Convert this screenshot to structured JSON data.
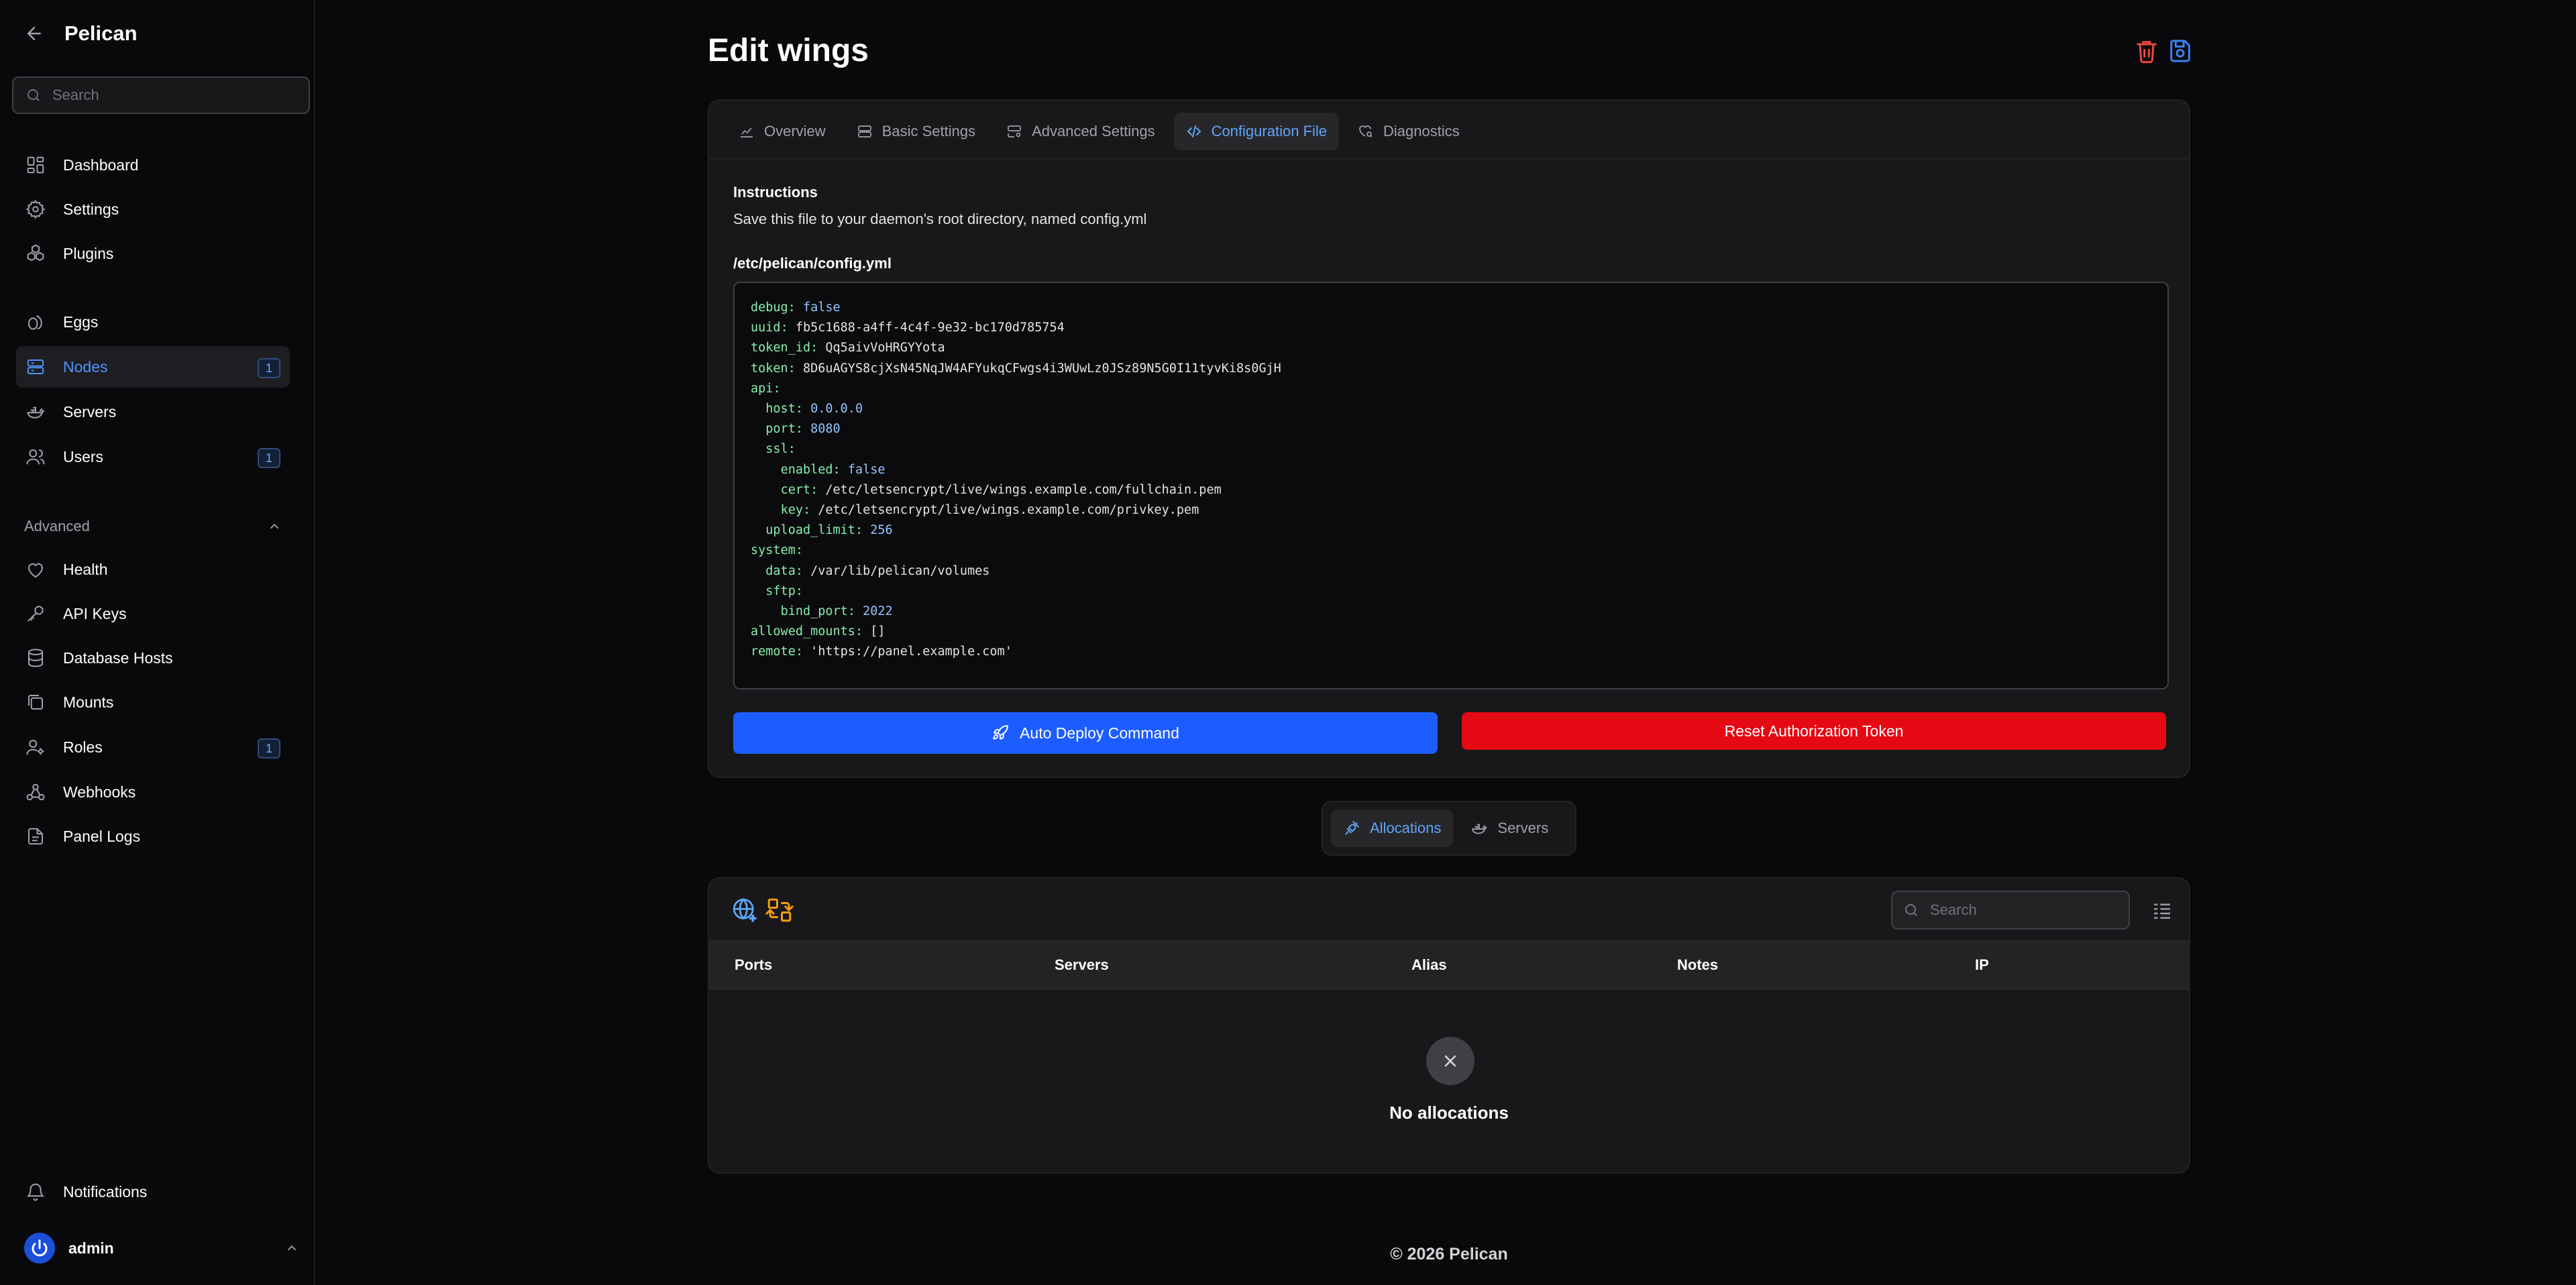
{
  "brand": {
    "name": "Pelican"
  },
  "sidebar": {
    "search_placeholder": "Search",
    "items": [
      {
        "label": "Dashboard"
      },
      {
        "label": "Settings"
      },
      {
        "label": "Plugins"
      },
      {
        "label": "Eggs"
      },
      {
        "label": "Nodes",
        "badge": "1",
        "active": true
      },
      {
        "label": "Servers"
      },
      {
        "label": "Users",
        "badge": "1"
      }
    ],
    "advanced_label": "Advanced",
    "advanced_items": [
      {
        "label": "Health"
      },
      {
        "label": "API Keys"
      },
      {
        "label": "Database Hosts"
      },
      {
        "label": "Mounts"
      },
      {
        "label": "Roles",
        "badge": "1"
      },
      {
        "label": "Webhooks"
      },
      {
        "label": "Panel Logs"
      }
    ],
    "notifications_label": "Notifications",
    "user": {
      "name": "admin"
    }
  },
  "header": {
    "title": "Edit wings"
  },
  "tabs": [
    {
      "label": "Overview"
    },
    {
      "label": "Basic Settings"
    },
    {
      "label": "Advanced Settings"
    },
    {
      "label": "Configuration File",
      "active": true
    },
    {
      "label": "Diagnostics"
    }
  ],
  "config": {
    "instructions_title": "Instructions",
    "instructions_text": "Save this file to your daemon's root directory, named config.yml",
    "file_path": "/etc/pelican/config.yml",
    "lines": [
      {
        "indent": "",
        "key": "debug",
        "value": "false",
        "kind": "bool"
      },
      {
        "indent": "",
        "key": "uuid",
        "value": "fb5c1688-a4ff-4c4f-9e32-bc170d785754",
        "kind": "str"
      },
      {
        "indent": "",
        "key": "token_id",
        "value": "Qq5aivVoHRGYYota",
        "kind": "str"
      },
      {
        "indent": "",
        "key": "token",
        "value": "8D6uAGYS8cjXsN45NqJW4AFYukqCFwgs4i3WUwLz0JSz89N5G0I11tyvKi8s0GjH",
        "kind": "str"
      },
      {
        "indent": "",
        "key": "api",
        "value": "",
        "kind": "str"
      },
      {
        "indent": "  ",
        "key": "host",
        "value": "0.0.0.0",
        "kind": "num"
      },
      {
        "indent": "  ",
        "key": "port",
        "value": "8080",
        "kind": "num"
      },
      {
        "indent": "  ",
        "key": "ssl",
        "value": "",
        "kind": "str"
      },
      {
        "indent": "    ",
        "key": "enabled",
        "value": "false",
        "kind": "bool"
      },
      {
        "indent": "    ",
        "key": "cert",
        "value": "/etc/letsencrypt/live/wings.example.com/fullchain.pem",
        "kind": "str"
      },
      {
        "indent": "    ",
        "key": "key",
        "value": "/etc/letsencrypt/live/wings.example.com/privkey.pem",
        "kind": "str"
      },
      {
        "indent": "  ",
        "key": "upload_limit",
        "value": "256",
        "kind": "num"
      },
      {
        "indent": "",
        "key": "system",
        "value": "",
        "kind": "str"
      },
      {
        "indent": "  ",
        "key": "data",
        "value": "/var/lib/pelican/volumes",
        "kind": "str"
      },
      {
        "indent": "  ",
        "key": "sftp",
        "value": "",
        "kind": "str"
      },
      {
        "indent": "    ",
        "key": "bind_port",
        "value": "2022",
        "kind": "num"
      },
      {
        "indent": "",
        "key": "allowed_mounts",
        "value": "[]",
        "kind": "str"
      },
      {
        "indent": "",
        "key": "remote",
        "value": "'https://panel.example.com'",
        "kind": "str"
      }
    ],
    "deploy_label": "Auto Deploy Command",
    "reset_label": "Reset Authorization Token"
  },
  "subtabs": [
    {
      "label": "Allocations",
      "active": true
    },
    {
      "label": "Servers"
    }
  ],
  "table": {
    "search_placeholder": "Search",
    "columns": [
      "Ports",
      "Servers",
      "Alias",
      "Notes",
      "IP"
    ],
    "empty_text": "No allocations"
  },
  "footer": {
    "text": "© 2026 Pelican"
  },
  "colors": {
    "accent": "#3b82f6",
    "danger": "#e50914",
    "background": "#09090b",
    "card": "#18181b"
  }
}
